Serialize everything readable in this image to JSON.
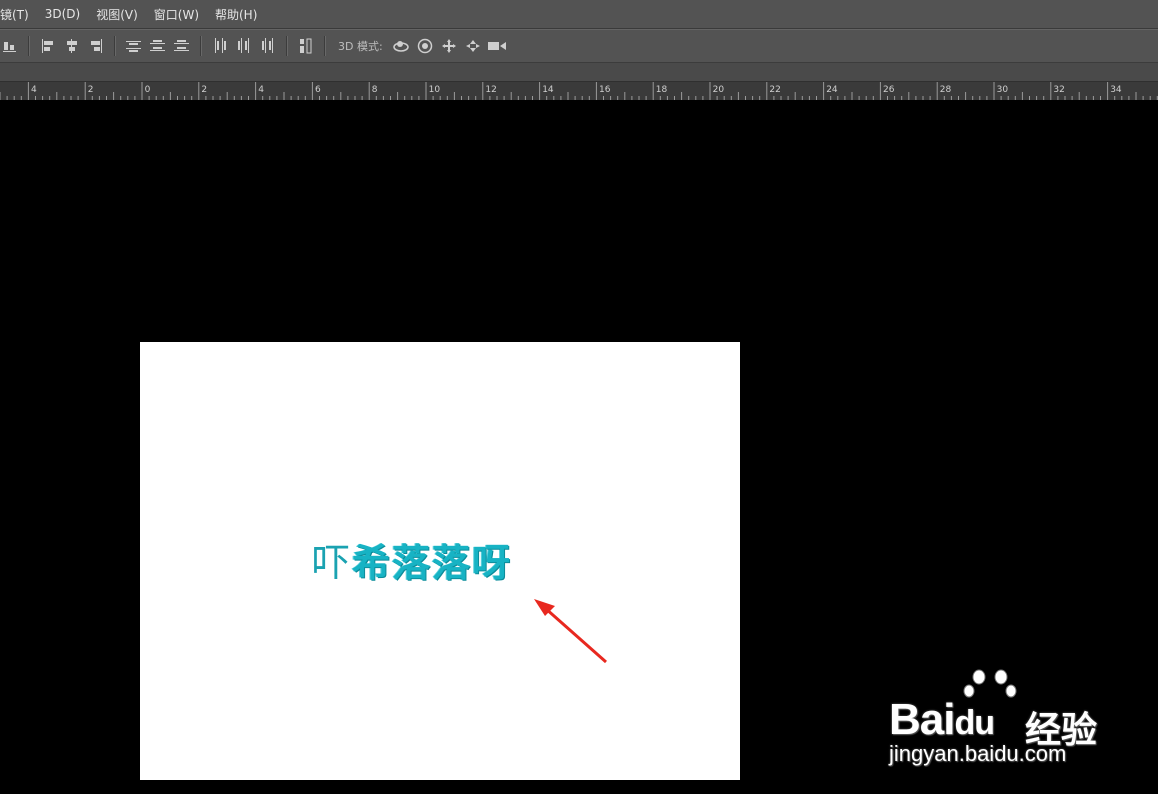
{
  "menu": {
    "items": [
      "镜(T)",
      "3D(D)",
      "视图(V)",
      "窗口(W)",
      "帮助(H)"
    ]
  },
  "options": {
    "mode_label": "3D 模式:",
    "align_icons": [
      "align-bottom-icon",
      "align-left-edge-icon",
      "align-h-center-icon",
      "align-right-edge-icon",
      "distribute-top-icon",
      "distribute-v-center-icon",
      "distribute-bottom-icon",
      "distribute-left-icon",
      "distribute-h-center-icon",
      "distribute-right-icon",
      "auto-align-icon"
    ],
    "mode_icons": [
      "rotate-3d-icon",
      "roll-3d-icon",
      "drag-3d-icon",
      "slide-3d-icon",
      "scale-3d-icon"
    ]
  },
  "ruler": {
    "labels": [
      "4",
      "2",
      "0",
      "2",
      "4",
      "6",
      "8",
      "10",
      "12",
      "14",
      "16",
      "18",
      "20",
      "22",
      "24",
      "26",
      "28",
      "30",
      "32",
      "34"
    ]
  },
  "document": {
    "first_char": "吓",
    "styled_chars": "希落落呀"
  },
  "watermark": {
    "brand": "Bai",
    "brand_suffix": "du",
    "cn": "经验",
    "url": "jingyan.baidu.com"
  },
  "colors": {
    "text_teal": "#1aa2b1",
    "arrow_red": "#e8281f"
  }
}
